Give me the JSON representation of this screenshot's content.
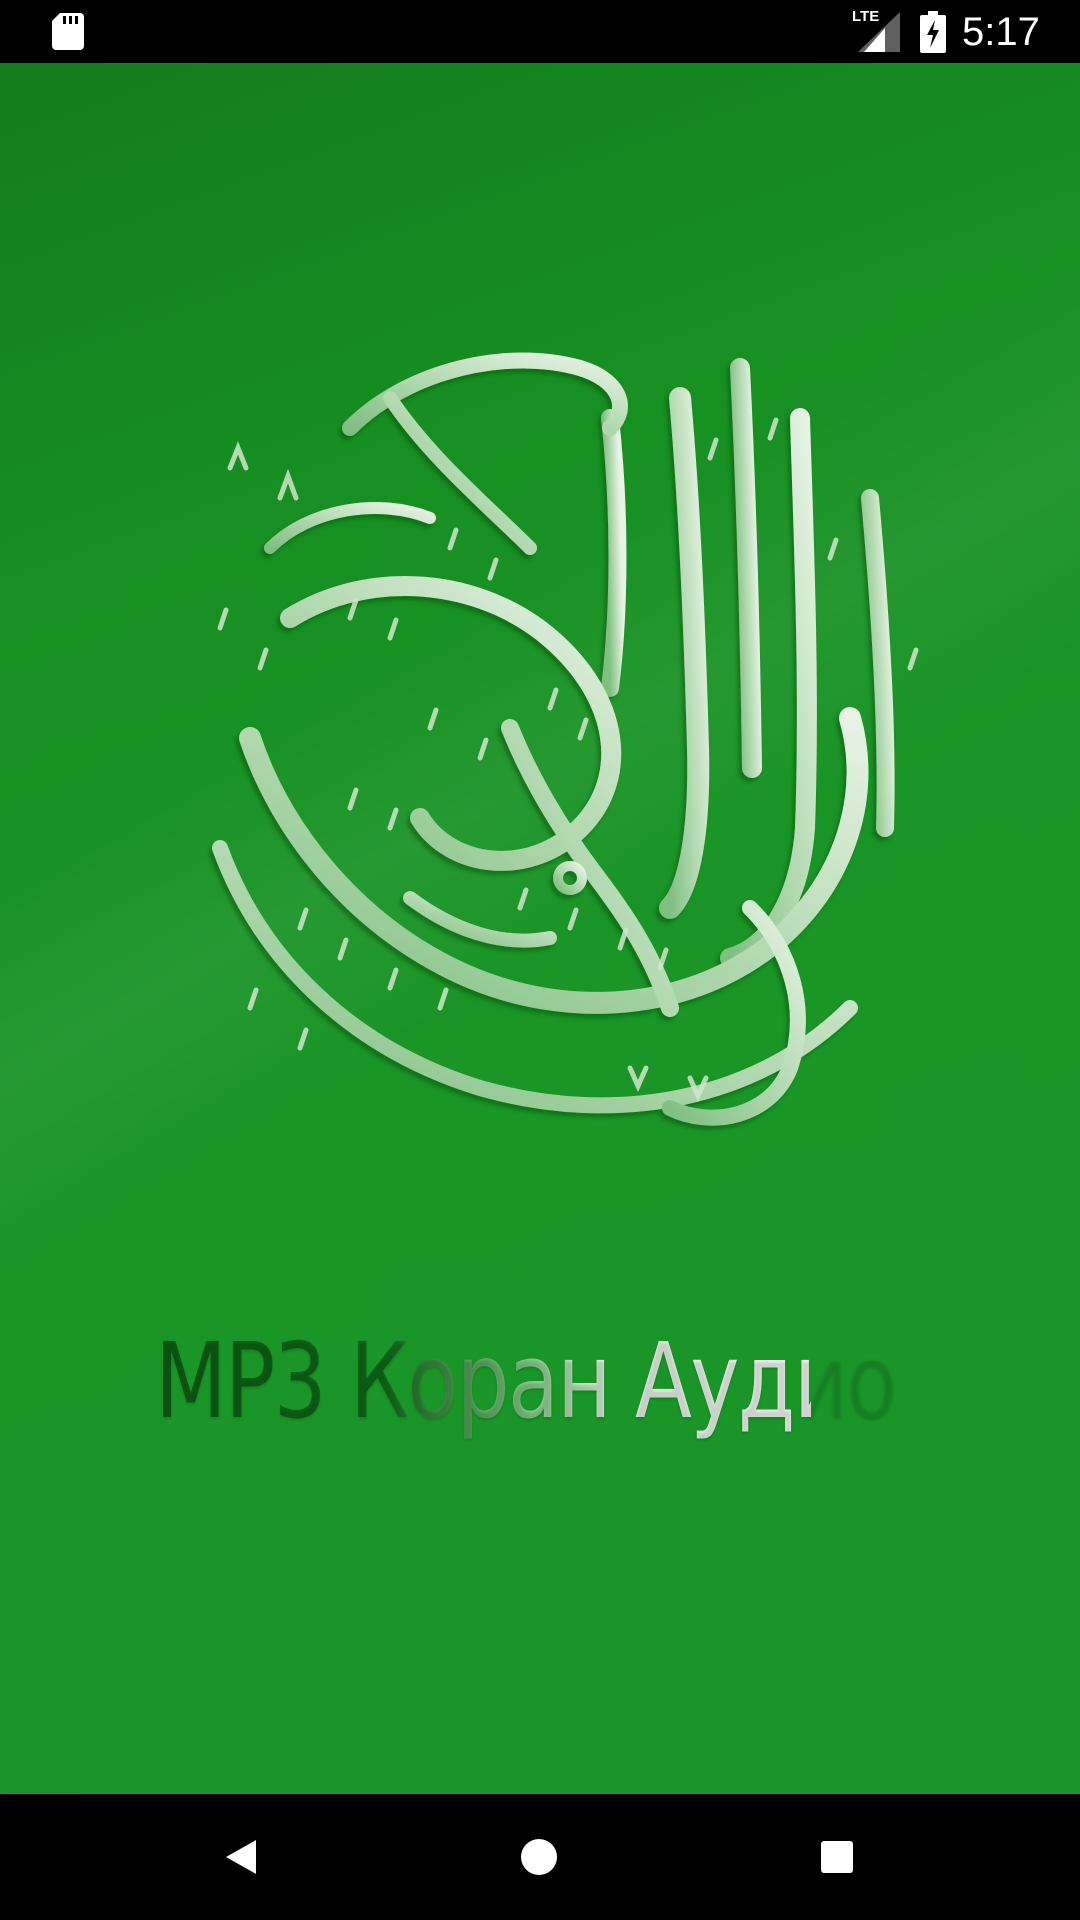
{
  "status_bar": {
    "time": "5:17",
    "network": "LTE",
    "icons": [
      "sd-card-icon",
      "signal-icon",
      "battery-charging-icon"
    ]
  },
  "splash": {
    "logo": "quran-calligraphy-logo",
    "title": "MP3 Коран Аудио",
    "background_color": "#1a9627"
  },
  "nav_bar": {
    "buttons": [
      "back-icon",
      "home-icon",
      "recents-icon"
    ]
  }
}
